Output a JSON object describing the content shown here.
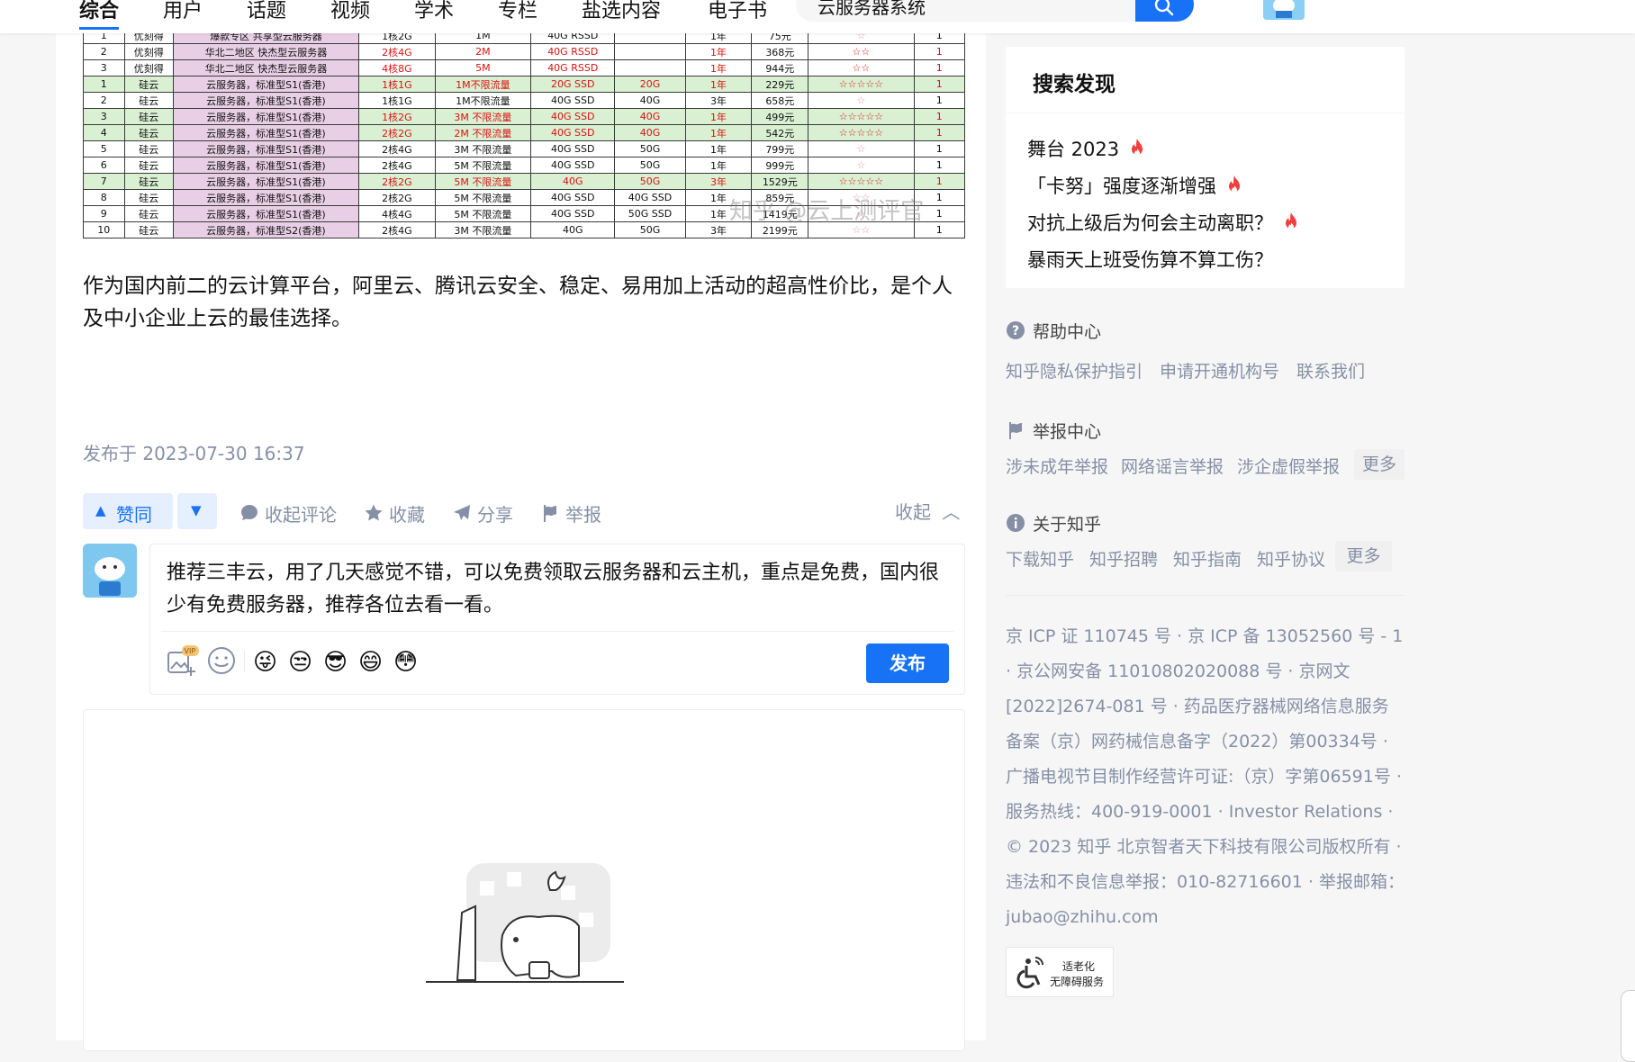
{
  "nav": {
    "tabs": [
      {
        "label": "综合",
        "active": true
      },
      {
        "label": "用户"
      },
      {
        "label": "话题"
      },
      {
        "label": "视频"
      },
      {
        "label": "学术"
      },
      {
        "label": "专栏"
      },
      {
        "label": "盐选内容"
      },
      {
        "label": "电子书"
      }
    ],
    "search_value": "云服务器系统",
    "accent_color": "#1772f6"
  },
  "table": {
    "rows": [
      [
        "1",
        "优刻得",
        "爆款专区 共享型云服务器",
        "1核2G",
        "1M",
        "40G RSSD",
        "",
        "1年",
        "75元",
        "☆",
        "1"
      ],
      [
        "2",
        "优刻得",
        "华北二地区 快杰型云服务器",
        "2核4G",
        "2M",
        "40G RSSD",
        "",
        "1年",
        "368元",
        "☆☆",
        "1"
      ],
      [
        "3",
        "优刻得",
        "华北二地区 快杰型云服务器",
        "4核8G",
        "5M",
        "40G RSSD",
        "",
        "1年",
        "944元",
        "☆☆",
        "1"
      ],
      [
        "1",
        "硅云",
        "云服务器，标准型S1(香港)",
        "1核1G",
        "1M不限流量",
        "20G SSD",
        "20G",
        "1年",
        "229元",
        "☆☆☆☆☆",
        "1"
      ],
      [
        "2",
        "硅云",
        "云服务器，标准型S1(香港)",
        "1核1G",
        "1M不限流量",
        "40G SSD",
        "40G",
        "3年",
        "658元",
        "☆",
        "1"
      ],
      [
        "3",
        "硅云",
        "云服务器，标准型S1(香港)",
        "1核2G",
        "3M 不限流量",
        "40G SSD",
        "40G",
        "1年",
        "499元",
        "☆☆☆☆☆",
        "1"
      ],
      [
        "4",
        "硅云",
        "云服务器，标准型S1(香港)",
        "2核2G",
        "2M 不限流量",
        "40G SSD",
        "40G",
        "1年",
        "542元",
        "☆☆☆☆☆",
        "1"
      ],
      [
        "5",
        "硅云",
        "云服务器，标准型S1(香港)",
        "2核4G",
        "3M 不限流量",
        "40G SSD",
        "50G",
        "1年",
        "799元",
        "☆",
        "1"
      ],
      [
        "6",
        "硅云",
        "云服务器，标准型S1(香港)",
        "2核4G",
        "5M 不限流量",
        "40G SSD",
        "50G",
        "1年",
        "999元",
        "☆",
        "1"
      ],
      [
        "7",
        "硅云",
        "云服务器，标准型S1(香港)",
        "2核2G",
        "5M 不限流量",
        "40G",
        "50G",
        "3年",
        "1529元",
        "☆☆☆☆☆",
        "1"
      ],
      [
        "8",
        "硅云",
        "云服务器，标准型S1(香港)",
        "2核2G",
        "5M 不限流量",
        "40G SSD",
        "40G SSD",
        "1年",
        "859元",
        "☆☆",
        "1"
      ],
      [
        "9",
        "硅云",
        "云服务器，标准型S1(香港)",
        "4核4G",
        "5M 不限流量",
        "40G SSD",
        "50G SSD",
        "1年",
        "1419元",
        "☆",
        "1"
      ],
      [
        "10",
        "硅云",
        "云服务器，标准型S2(香港)",
        "2核4G",
        "3M 不限流量",
        "40G",
        "50G",
        "3年",
        "2199元",
        "☆☆",
        "1"
      ]
    ],
    "highlight_rows": [
      3,
      5,
      6,
      9
    ],
    "red_rows": [
      1,
      2,
      3,
      5,
      6,
      9
    ],
    "watermark": "知乎 @云上测评官"
  },
  "article": {
    "paragraph": "作为国内前二的云计算平台，阿里云、腾讯云安全、稳定、易用加上活动的超高性价比，是个人及中小企业上云的最佳选择。",
    "published": "发布于 2023-07-30 16:37"
  },
  "actions": {
    "vote_up": "赞同",
    "collapse_comments": "收起评论",
    "favorite": "收藏",
    "share": "分享",
    "report": "举报",
    "collapse": "收起"
  },
  "composer": {
    "text": "推荐三丰云，用了几天感觉不错，可以免费领取云服务器和云主机，重点是免费，国内很少有免费服务器，推荐各位去看一看。",
    "vip_badge": "VIP",
    "emojis": [
      "😜",
      "😒",
      "😎",
      "😄",
      "😳"
    ],
    "publish": "发布"
  },
  "sidebar": {
    "search_discover": {
      "title": "搜索发现",
      "items": [
        "舞台 2023",
        "「卡努」强度逐渐增强",
        "对抗上级后为何会主动离职？",
        "暴雨天上班受伤算不算工伤？"
      ]
    },
    "help": {
      "title": "帮助中心",
      "links": [
        "知乎隐私保护指引",
        "申请开通机构号",
        "联系我们"
      ]
    },
    "report": {
      "title": "举报中心",
      "links": [
        "涉未成年举报",
        "网络谣言举报",
        "涉企虚假举报"
      ],
      "more": "更多"
    },
    "about": {
      "title": "关于知乎",
      "links": [
        "下载知乎",
        "知乎招聘",
        "知乎指南",
        "知乎协议"
      ],
      "more": "更多"
    },
    "footer_text": "京 ICP 证 110745 号 · 京 ICP 备 13052560 号 - 1 · 京公网安备 11010802020088 号 · 京网文[2022]2674-081 号 · 药品医疗器械网络信息服务备案（京）网药械信息备字（2022）第00334号 · 广播电视节目制作经营许可证:（京）字第06591号 · 服务热线：400-919-0001 · Investor Relations · © 2023 知乎 北京智者天下科技有限公司版权所有 · 违法和不良信息举报：010-82716601 · 举报邮箱：jubao@zhihu.com",
    "a11y": {
      "line1": "适老化",
      "line2": "无障碍服务"
    }
  }
}
